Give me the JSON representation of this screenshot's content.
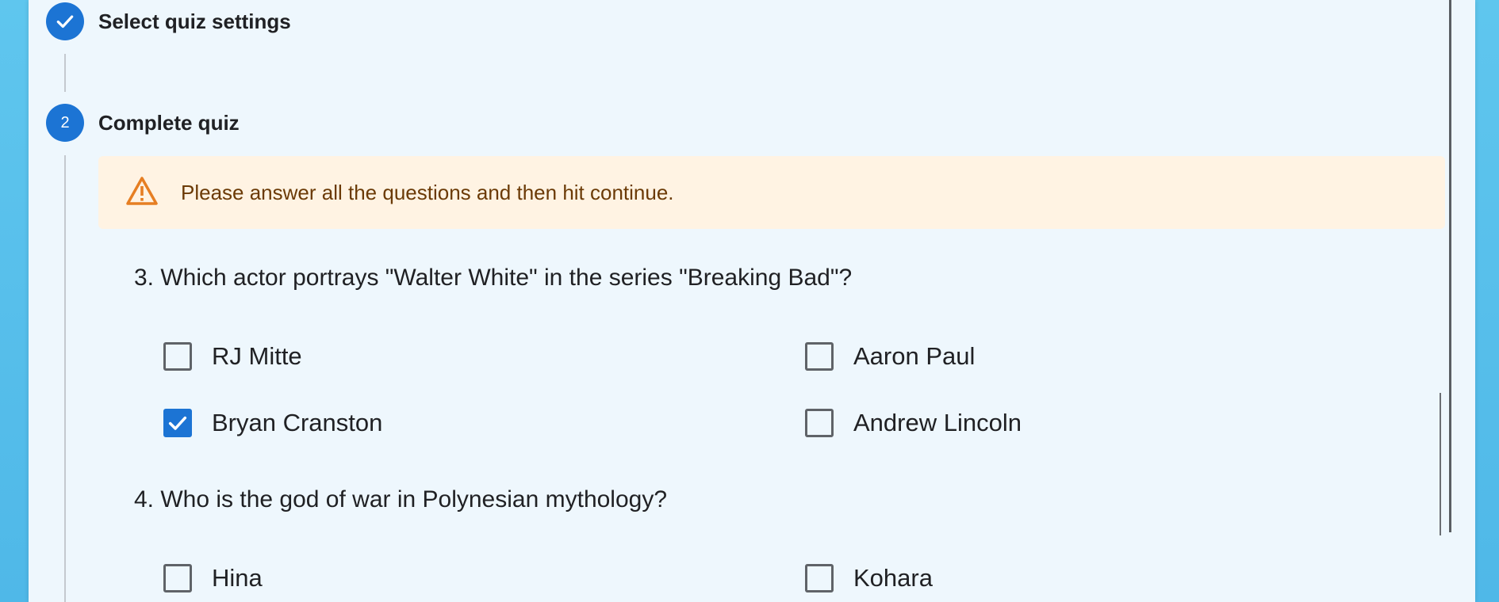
{
  "steps": [
    {
      "label": "Select quiz settings",
      "status": "completed"
    },
    {
      "label": "Complete quiz",
      "number": "2",
      "status": "active"
    }
  ],
  "alert": {
    "text": "Please answer all the questions and then hit continue.",
    "icon": "warning-icon",
    "color": "#e67e22"
  },
  "questions": [
    {
      "text": "3. Which actor portrays \"Walter White\" in the series \"Breaking Bad\"?",
      "options": [
        {
          "label": "RJ Mitte",
          "checked": false
        },
        {
          "label": "Aaron Paul",
          "checked": false
        },
        {
          "label": "Bryan Cranston",
          "checked": true
        },
        {
          "label": "Andrew Lincoln",
          "checked": false
        }
      ]
    },
    {
      "text": "4. Who is the god of war in Polynesian mythology?",
      "options": [
        {
          "label": "Hina",
          "checked": false
        },
        {
          "label": "Kohara",
          "checked": false
        }
      ]
    }
  ],
  "colors": {
    "accent": "#1c74d4",
    "alert_bg": "#fff3e3",
    "card_bg": "#eef7fd"
  }
}
